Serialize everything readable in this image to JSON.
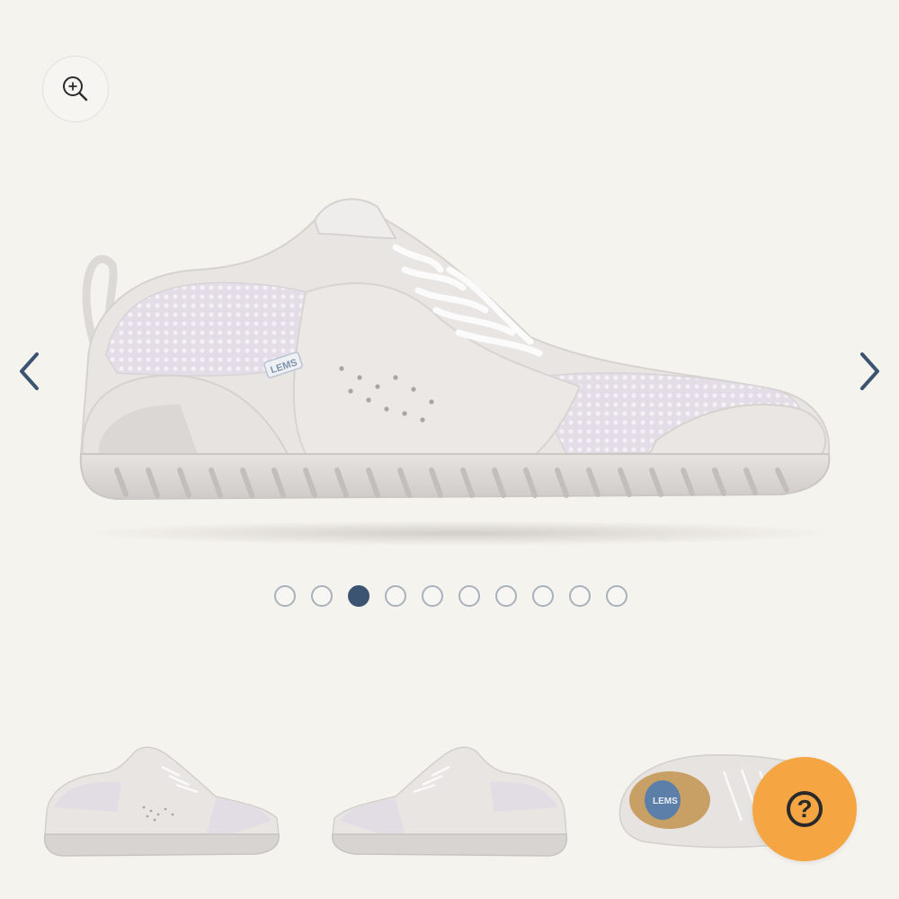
{
  "gallery": {
    "zoom_icon": "zoom-in-icon",
    "prev_icon": "chevron-left-icon",
    "next_icon": "chevron-right-icon",
    "brand_text": "LEMS",
    "active_slide": 3,
    "slide_count": 10
  },
  "thumbnails": [
    {
      "view": "side-left"
    },
    {
      "view": "side-right"
    },
    {
      "view": "top"
    }
  ],
  "help": {
    "label": "?",
    "icon": "help-icon"
  },
  "colors": {
    "background": "#f5f3ee",
    "accent": "#3b5472",
    "dot_border": "#a9b1bc",
    "help_button": "#f5a542",
    "shoe_body": "#e8e5e3",
    "shoe_mesh": "#e3dde6"
  }
}
